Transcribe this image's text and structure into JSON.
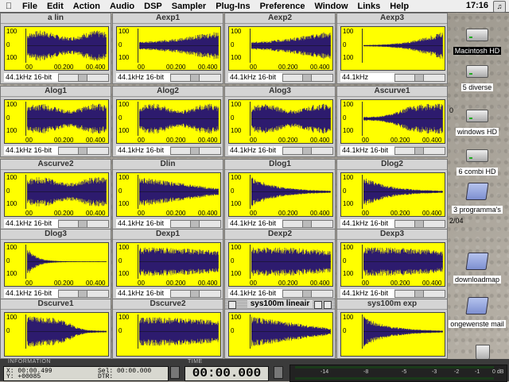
{
  "menubar": {
    "apple": "",
    "items": [
      "File",
      "Edit",
      "Action",
      "Audio",
      "DSP",
      "Sampler",
      "Plug-Ins",
      "Preference",
      "Window",
      "Links",
      "Help"
    ],
    "clock": "17:16"
  },
  "windows": [
    {
      "title": "a lin",
      "format": "44.1kHz 16-bit",
      "yticks": [
        "100",
        "0",
        "100"
      ],
      "xticks": [
        "00",
        "00.200",
        "00.400"
      ],
      "shape": "flat"
    },
    {
      "title": "Aexp1",
      "format": "44.1kHz 16-bit",
      "yticks": [
        "100",
        "0",
        "100"
      ],
      "xticks": [
        "00",
        "00.200",
        "00.400"
      ],
      "shape": "rise"
    },
    {
      "title": "Aexp2",
      "format": "44.1kHz 16-bit",
      "yticks": [
        "100",
        "0",
        "100"
      ],
      "xticks": [
        "00",
        "00.200",
        "00.400"
      ],
      "shape": "rise"
    },
    {
      "title": "Aexp3",
      "format": "44.1kHz",
      "yticks": [
        "100",
        "0",
        "100"
      ],
      "xticks": [
        "",
        "",
        ""
      ],
      "shape": "rise2"
    },
    {
      "title": "Alog1",
      "format": "44.1kHz 16-bit",
      "yticks": [
        "100",
        "0",
        "100"
      ],
      "xticks": [
        "00",
        "00.200",
        "00.400"
      ],
      "shape": "flat"
    },
    {
      "title": "Alog2",
      "format": "44.1kHz 16-bit",
      "yticks": [
        "100",
        "0",
        "100"
      ],
      "xticks": [
        "00",
        "00.200",
        "00.400"
      ],
      "shape": "flat"
    },
    {
      "title": "Alog3",
      "format": "44.1kHz 16-bit",
      "yticks": [
        "100",
        "0",
        "100"
      ],
      "xticks": [
        "00",
        "00.200",
        "00.400"
      ],
      "shape": "flat"
    },
    {
      "title": "Ascurve1",
      "format": "44.1kHz 16-bit",
      "yticks": [
        "100",
        "0",
        "100"
      ],
      "xticks": [
        "00",
        "00.200",
        "00.400"
      ],
      "shape": "scurve"
    },
    {
      "title": "Ascurve2",
      "format": "44.1kHz 16-bit",
      "yticks": [
        "100",
        "0",
        "100"
      ],
      "xticks": [
        "00",
        "00.200",
        "00.400"
      ],
      "shape": "flat"
    },
    {
      "title": "Dlin",
      "format": "44.1kHz 16-bit",
      "yticks": [
        "100",
        "0",
        "100"
      ],
      "xticks": [
        "00",
        "00.200",
        "00.400"
      ],
      "shape": "lindown"
    },
    {
      "title": "Dlog1",
      "format": "44.1kHz 16-bit",
      "yticks": [
        "100",
        "0",
        "100"
      ],
      "xticks": [
        "00",
        "00.200",
        "00.400"
      ],
      "shape": "decay"
    },
    {
      "title": "Dlog2",
      "format": "44.1kHz 16-bit",
      "yticks": [
        "100",
        "0",
        "100"
      ],
      "xticks": [
        "00",
        "00.200",
        "00.400"
      ],
      "shape": "decay"
    },
    {
      "title": "Dlog3",
      "format": "44.1kHz 16-bit",
      "yticks": [
        "100",
        "0",
        "100"
      ],
      "xticks": [
        "00",
        "00.200",
        "00.400"
      ],
      "shape": "fastdecay"
    },
    {
      "title": "Dexp1",
      "format": "44.1kHz 16-bit",
      "yticks": [
        "100",
        "0",
        "100"
      ],
      "xticks": [
        "00",
        "00.200",
        "00.400"
      ],
      "shape": "flatdown"
    },
    {
      "title": "Dexp2",
      "format": "44.1kHz 16-bit",
      "yticks": [
        "100",
        "0",
        "100"
      ],
      "xticks": [
        "00",
        "00.200",
        "00.400"
      ],
      "shape": "flatdown"
    },
    {
      "title": "Dexp3",
      "format": "44.1kHz 16-bit",
      "yticks": [
        "100",
        "0",
        "100"
      ],
      "xticks": [
        "00",
        "00.200",
        "00.400"
      ],
      "shape": "flatdown"
    },
    {
      "title": "Dscurve1",
      "format": "",
      "yticks": [
        "100",
        "0",
        ""
      ],
      "xticks": [
        "",
        "",
        ""
      ],
      "shape": "scurvedown"
    },
    {
      "title": "Dscurve2",
      "format": "",
      "yticks": [
        "100",
        "0",
        ""
      ],
      "xticks": [
        "",
        "",
        ""
      ],
      "shape": "flatdown"
    },
    {
      "title": "sys100m lineair",
      "format": "",
      "yticks": [
        "100",
        "0",
        ""
      ],
      "xticks": [
        "",
        "",
        ""
      ],
      "shape": "lindown",
      "active": true
    },
    {
      "title": "sys100m exp",
      "format": "",
      "yticks": [
        "100",
        "0",
        ""
      ],
      "xticks": [
        "",
        "",
        ""
      ],
      "shape": "decay"
    }
  ],
  "desktop": {
    "icons": [
      {
        "label": "Macintosh HD",
        "kind": "hd",
        "selected": true
      },
      {
        "label": "5 diverse",
        "kind": "hd"
      },
      {
        "label": "windows HD",
        "kind": "hd"
      },
      {
        "label": "6 combi HD",
        "kind": "hd"
      },
      {
        "label": "3 programma's",
        "kind": "folder"
      },
      {
        "label": "downloadmap",
        "kind": "folder"
      },
      {
        "label": "ongewenste mail",
        "kind": "folder"
      }
    ],
    "fragments": [
      "0",
      "2/04"
    ]
  },
  "bottombar": {
    "info_label": "INFORMATION",
    "x_label": "X: 00:00.499",
    "y_label": "Y: +00085",
    "sel_label": "Sel: 00:00.000",
    "dtr_label": "DTR:",
    "time_label": "TIME",
    "time_value": "00:00.000",
    "meter_ticks": [
      "-14",
      "-8",
      "-5",
      "-3",
      "-2",
      "-1",
      "0 dB"
    ]
  },
  "colors": {
    "plot_bg": "#ffff00",
    "waveform": "#2d1b6e",
    "desktop": "#a9a49c"
  }
}
